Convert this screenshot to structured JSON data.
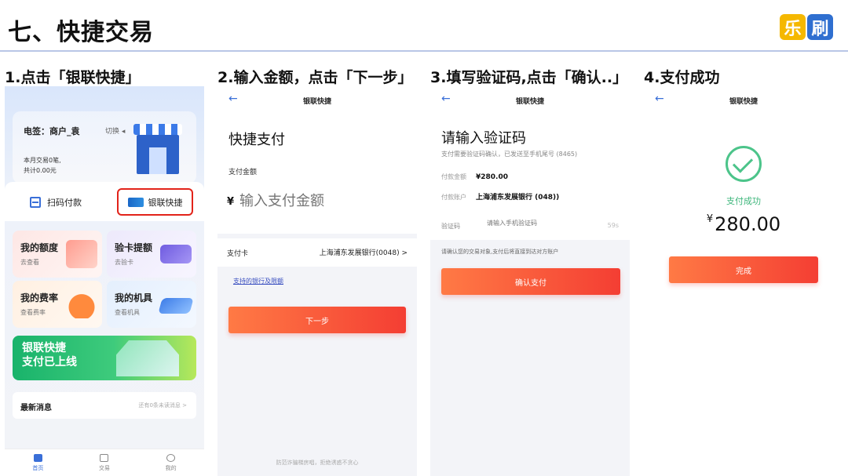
{
  "slide": {
    "title": "七、快捷交易",
    "logo": [
      "乐",
      "刷"
    ]
  },
  "steps": [
    "1.点击「银联快捷」",
    "2.输入金额，点击「下一步」",
    "3.填写验证码,点击「确认..」",
    "4.支付成功"
  ],
  "phone1": {
    "merchant": "电签：商户_袁",
    "switch_label": "切换 ◂",
    "stats_line1": "本月交易0笔,",
    "stats_line2": "共计0.00元",
    "scan_label": "扫码付款",
    "unionpay_label": "银联快捷",
    "tiles": [
      {
        "title": "我的额度",
        "sub": "去查看"
      },
      {
        "title": "验卡提额",
        "sub": "去验卡"
      },
      {
        "title": "我的费率",
        "sub": "查看费率"
      },
      {
        "title": "我的机具",
        "sub": "查看机具"
      }
    ],
    "banner_line1": "银联快捷",
    "banner_line2": "支付已上线",
    "news_title": "最新消息",
    "news_meta": "还有0条未读消息 >",
    "tabs": [
      "首页",
      "交易",
      "我的"
    ]
  },
  "nav": {
    "back": "←",
    "title": "银联快捷"
  },
  "phone2": {
    "heading": "快捷支付",
    "amount_label": "支付金额",
    "yen": "¥",
    "amount_placeholder": "输入支付金额",
    "card_label": "支付卡",
    "card_value": "上海浦东发展银行(0048) >",
    "link": "支持的银行及限额",
    "next_button": "下一步",
    "footer": "防范诈骗梯房唱，拒绝诱惑不贪心"
  },
  "phone3": {
    "heading": "请输入验证码",
    "sub": "支付需要验证码确认，已发送至手机尾号 (8465)",
    "amount_label": "付款金额",
    "amount_value": "¥280.00",
    "account_label": "付款账户",
    "account_value": "上海浦东发展银行 (048))",
    "code_label": "验证码",
    "code_placeholder": "请输入手机验证码",
    "countdown": "59s",
    "note": "请确认您的交易对象,支付后将直接到达对方账户",
    "confirm_button": "确认支付"
  },
  "phone4": {
    "success_text": "支付成功",
    "yen": "¥",
    "amount": "280.00",
    "done_button": "完成"
  },
  "colors": {
    "accent_blue": "#3a6fd8",
    "button_start": "#ff7a45",
    "button_end": "#f43e33",
    "success_green": "#4cc48a",
    "highlight_red": "#e2231a"
  }
}
